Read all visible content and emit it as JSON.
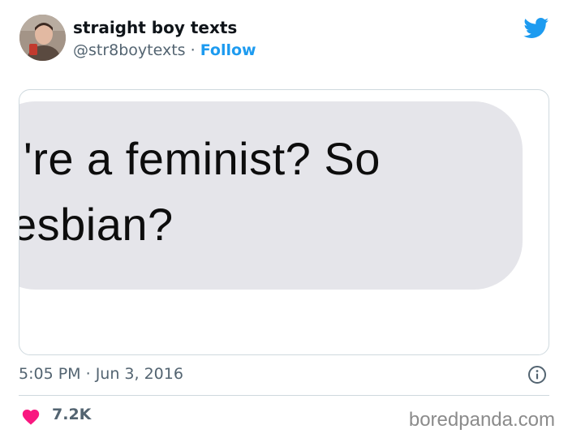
{
  "author": {
    "name": "straight boy texts",
    "handle": "@str8boytexts",
    "separator": "·",
    "follow_label": "Follow"
  },
  "media": {
    "bubble_lines": [
      "'re a feminist? So",
      "esbian?"
    ]
  },
  "meta": {
    "time": "5:05 PM",
    "separator": "·",
    "date": "Jun 3, 2016"
  },
  "engagement": {
    "likes": "7.2K"
  },
  "watermark": "boredpanda.com",
  "colors": {
    "accent": "#1d9bf0",
    "like": "#f91880",
    "secondary_text": "#536471",
    "bubble": "#e5e5ea"
  },
  "icons": {
    "brand": "twitter-bird-icon",
    "info": "info-icon",
    "like": "heart-icon"
  }
}
